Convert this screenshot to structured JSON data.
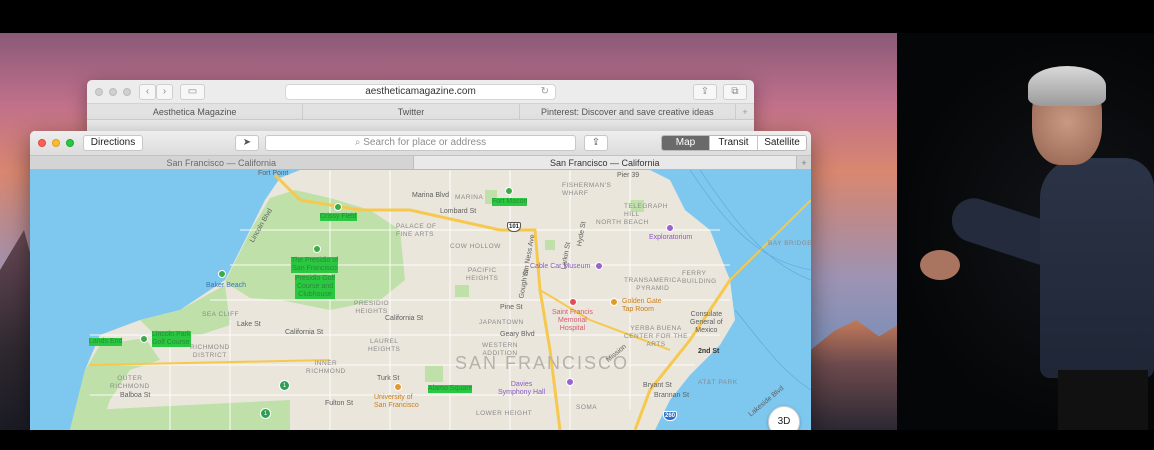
{
  "safari": {
    "url": "aestheticamagazine.com",
    "tabs": [
      "Aesthetica Magazine",
      "Twitter",
      "Pinterest: Discover and save creative ideas"
    ],
    "back_icon": "chevron-left-icon",
    "forward_icon": "chevron-right-icon",
    "sidebar_icon": "sidebar-icon",
    "share_icon": "share-icon",
    "tabs_icon": "tabs-overview-icon",
    "reload_icon": "reload-icon"
  },
  "maps": {
    "directions_label": "Directions",
    "search_placeholder": "Search for place or address",
    "modes": [
      "Map",
      "Transit",
      "Satellite"
    ],
    "active_mode": "Map",
    "tabs": [
      "San Francisco — California",
      "San Francisco — California"
    ],
    "add_tab": "+",
    "btn_3d": "3D",
    "city_label": "SAN FRANCISCO",
    "labels": {
      "fort_point": "Fort Point",
      "crissy_field": "Crissy Field",
      "marina_blvd": "Marina Blvd",
      "marina": "MARINA",
      "fort_mason": "Fort Mason",
      "fishermans_wharf": "FISHERMAN'S\nWHARF",
      "pier39": "Pier 39",
      "north_beach": "NORTH BEACH",
      "telegraph_hill": "TELEGRAPH\nHILL",
      "exploratorium": "Exploratorium",
      "bay_bridge": "BAY BRIDGE",
      "palace_fine_arts": "PALACE OF\nFINE ARTS",
      "cow_hollow": "COW HOLLOW",
      "presidio": "The Presidio of\nSan Francisco",
      "presidio_golf": "Presidio Golf\nCourse and\nClubhouse",
      "baker_beach": "Baker Beach",
      "pacific_heights": "PACIFIC\nHEIGHTS",
      "cable_car": "Cable Car Museum",
      "transamerica": "TRANSAMERICA\nPYRAMID",
      "ferry": "FERRY\nBUILDING",
      "presidio_heights": "PRESIDIO\nHEIGHTS",
      "pine_st": "Pine St",
      "golden_gate_tap": "Golden Gate\nTap Room",
      "sea_cliff": "SEA CLIFF",
      "lake_st": "Lake St",
      "california_st": "California St",
      "california_st2": "California St",
      "japantown": "JAPANTOWN",
      "saint_francis": "Saint Francis\nMemorial\nHospital",
      "yerba_buena": "YERBA BUENA\nCENTER FOR THE\nARTS",
      "consulate": "Consulate\nGeneral of\nMexico",
      "lands_end": "Lands End",
      "lincoln_park": "Lincoln Park\nGolf Course",
      "laurel_heights": "LAUREL\nHEIGHTS",
      "geary_blvd": "Geary Blvd",
      "western_addition": "WESTERN\nADDITION",
      "second_st": "2nd St",
      "richmond_district": "RICHMOND\nDISTRICT",
      "inner_richmond": "INNER\nRICHMOND",
      "outer_richmond": "OUTER\nRICHMOND",
      "balboa_st": "Balboa St",
      "turk_st": "Turk St",
      "alamo_square": "Alamo Square",
      "davies": "Davies\nSymphony Hall",
      "att_park": "AT&T PARK",
      "bryant_st": "Bryant St",
      "brannan_st": "Brannan St",
      "fulton_st": "Fulton St",
      "usf": "University of\nSan Francisco",
      "lower_haight": "LOWER HEIGHT",
      "soma": "SOMA",
      "lincoln_blvd": "Lincoln Blvd",
      "van_ness": "Van Ness Ave",
      "lombard": "Lombard St",
      "gough": "Gough St",
      "larkin": "Larkin St",
      "hyde": "Hyde St",
      "mission": "Mission",
      "lakeside": "Lakeside Blvd"
    },
    "shields": [
      "101",
      "260"
    ],
    "transit_marker": "1"
  },
  "colors": {
    "water": "#7ec7ef",
    "park": "#bfe0a8",
    "land": "#ebe6dc",
    "highway": "#f6c84d",
    "active_mode_bg": "#6a6a6a"
  }
}
